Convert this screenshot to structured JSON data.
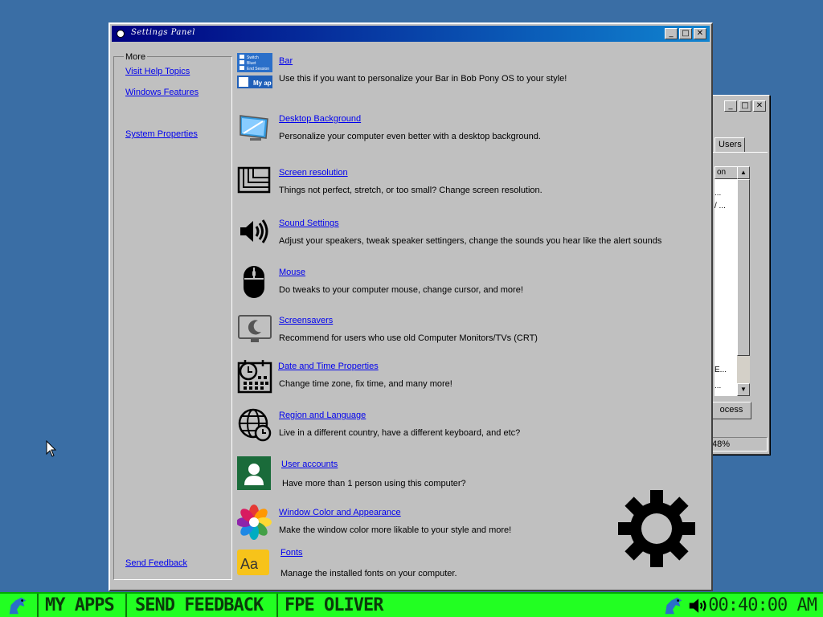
{
  "window": {
    "title": "Settings Panel",
    "controls": {
      "minimize": "_",
      "maximize": "□",
      "close": "✕"
    }
  },
  "sidebar": {
    "legend": "More",
    "links": [
      "Visit Help Topics",
      "Windows Features",
      "System Properties"
    ],
    "feedback": "Send Feedback"
  },
  "items": [
    {
      "name": "Bar",
      "desc": "Use this if you want to personalize your Bar in Bob Pony OS to your style!",
      "icon": "bar-preview-icon"
    },
    {
      "name": "Desktop Background",
      "desc": "Personalize your computer even better with a desktop background.",
      "icon": "monitor-wallpaper-icon"
    },
    {
      "name": "Screen resolution",
      "desc": "Things not perfect, stretch, or too small? Change screen resolution.",
      "icon": "resolution-icon"
    },
    {
      "name": "Sound Settings",
      "desc": "Adjust your speakers, tweak speaker settingers, change the sounds you hear like the alert sounds",
      "icon": "speaker-icon"
    },
    {
      "name": "Mouse",
      "desc": "Do tweaks to your computer mouse, change cursor, and more!",
      "icon": "mouse-icon"
    },
    {
      "name": "Screensavers",
      "desc": "Recommend for users who use old Computer Monitors/TVs (CRT)",
      "icon": "screensaver-icon"
    },
    {
      "name": "Date and Time Properties",
      "desc": "Change time zone, fix time, and many more!",
      "icon": "calendar-clock-icon"
    },
    {
      "name": "Region and Language",
      "desc": "Live in a different country, have a different keyboard, and etc?",
      "icon": "globe-clock-icon"
    },
    {
      "name": "User accounts",
      "desc": "Have more than 1 person using this computer?",
      "icon": "user-icon"
    },
    {
      "name": "Window Color and Appearance",
      "desc": "Make the window color more likable to your style and more!",
      "icon": "color-wheel-icon"
    },
    {
      "name": "Fonts",
      "desc": "Manage the installed fonts on your computer.",
      "icon": "font-icon"
    }
  ],
  "bar_icon_text": {
    "line1": "Switch",
    "line2": "Bluet",
    "line3": "End Session",
    "line4": "My ap"
  },
  "font_icon_text": "Aa",
  "bg_window": {
    "tab": "Users",
    "column": "on",
    "rows": [
      "...",
      "/ ...",
      "E...",
      "..."
    ],
    "button": "ocess",
    "status": "48%"
  },
  "taskbar": {
    "my_apps": "MY APPS",
    "send_feedback": "SEND FEEDBACK",
    "user": "FPE OLIVER",
    "clock": "00:40:00 AM"
  },
  "colors": {
    "desktop": "#3a6ea5",
    "taskbar": "#22ff22",
    "titlebar_start": "#000080",
    "titlebar_end": "#1084d0",
    "link": "#0000ee"
  }
}
